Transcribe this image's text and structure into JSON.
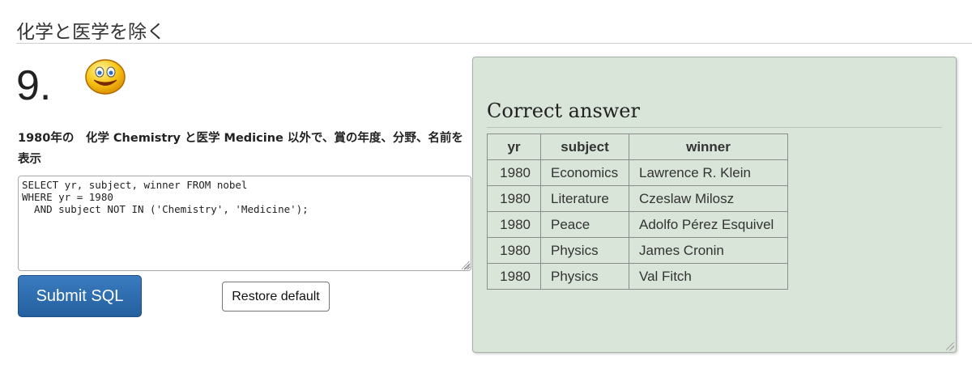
{
  "page": {
    "heading": "化学と医学を除く"
  },
  "question": {
    "number": "9.",
    "text": "1980年の　化学 Chemistry と医学 Medicine 以外で、賞の年度、分野、名前を表示"
  },
  "editor": {
    "sql": "SELECT yr, subject, winner FROM nobel\nWHERE yr = 1980\n  AND subject NOT IN ('Chemistry', 'Medicine');"
  },
  "buttons": {
    "submit_label": "Submit SQL",
    "restore_label": "Restore default"
  },
  "answer": {
    "title": "Correct answer",
    "columns": [
      "yr",
      "subject",
      "winner"
    ],
    "rows": [
      [
        "1980",
        "Economics",
        "Lawrence R. Klein"
      ],
      [
        "1980",
        "Literature",
        "Czeslaw Milosz"
      ],
      [
        "1980",
        "Peace",
        "Adolfo Pérez Esquivel"
      ],
      [
        "1980",
        "Physics",
        "James Cronin"
      ],
      [
        "1980",
        "Physics",
        "Val Fitch"
      ]
    ]
  },
  "icons": {
    "status": "smiley-face-icon"
  },
  "colors": {
    "submit_bg": "#2a68a8",
    "answer_panel_bg": "#d9e5d8"
  }
}
